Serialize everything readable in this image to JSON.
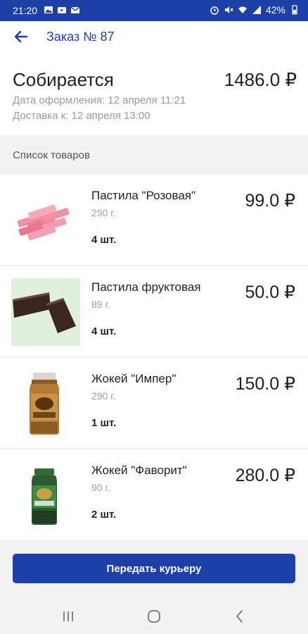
{
  "status_bar": {
    "time": "21:20",
    "battery": "42%",
    "left_icons": [
      "image-icon",
      "video-icon",
      "mail-icon"
    ],
    "right_icons": [
      "alarm-icon",
      "mute-icon",
      "wifi-icon",
      "signal-icon",
      "battery-icon"
    ]
  },
  "header": {
    "title": "Заказ № 87",
    "back_icon": "arrow-left-icon"
  },
  "order": {
    "status": "Собирается",
    "total": "1486.0 ₽",
    "created": "Дата оформления: 12 апреля 11:21",
    "delivery": "Доставка к: 12 апреля 13:00"
  },
  "list": {
    "heading": "Список товаров",
    "items": [
      {
        "name": "Пастила \"Розовая\"",
        "weight": "290 г.",
        "qty": "4 шт.",
        "price": "99.0 ₽"
      },
      {
        "name": "Пастила фруктовая",
        "weight": "89 г.",
        "qty": "4 шт.",
        "price": "50.0 ₽"
      },
      {
        "name": "Жокей \"Импер\"",
        "weight": "290 г.",
        "qty": "1 шт.",
        "price": "150.0 ₽"
      },
      {
        "name": "Жокей \"Фаворит\"",
        "weight": "90 г.",
        "qty": "2 шт.",
        "price": "280.0 ₽"
      }
    ]
  },
  "action": {
    "button_label": "Передать курьеру"
  },
  "nav": {
    "icons": [
      "recent-apps-icon",
      "home-icon",
      "back-nav-icon"
    ]
  },
  "colors": {
    "accent": "#1d3fa8",
    "secondary_text": "#9a9a9a"
  }
}
